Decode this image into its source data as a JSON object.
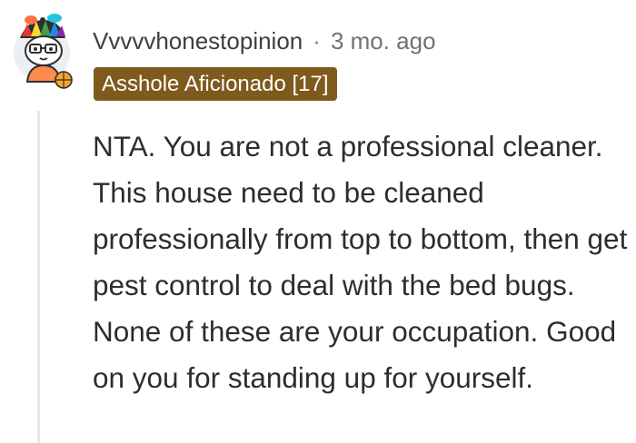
{
  "comment": {
    "username": "Vvvvvhonestopinion",
    "separator": "·",
    "age": "3 mo. ago",
    "flair": "Asshole Aficionado [17]",
    "body": "NTA. You are not a professional cleaner. This house need to be cleaned professionally from top to bottom, then get pest control to deal with the bed bugs. None of these are your occupation. Good on you for standing up for yourself.",
    "avatar_icon": "user-avatar-icon"
  },
  "colors": {
    "flair_background": "#7e5a1c",
    "flair_text": "#ffffff",
    "meta_text": "#4a4d50",
    "body_text": "#2b2e31",
    "thread_line": "#e4e6e8"
  }
}
